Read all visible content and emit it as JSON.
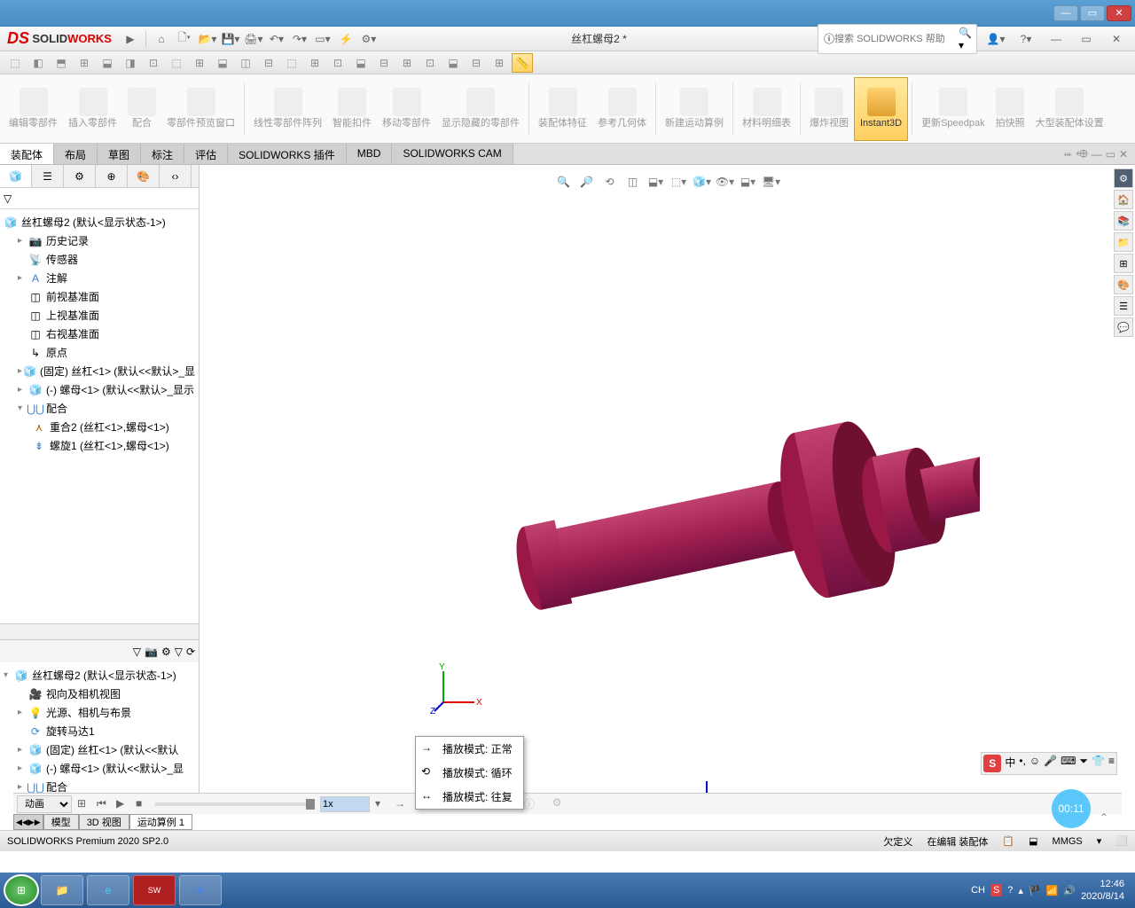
{
  "logo": {
    "solid": "SOLID",
    "works": "WORKS"
  },
  "doc_title": "丝杠螺母2 *",
  "search_placeholder": "搜索 SOLIDWORKS 帮助",
  "ribbon": {
    "items": [
      {
        "label": "编辑零部件"
      },
      {
        "label": "插入零部件"
      },
      {
        "label": "配合"
      },
      {
        "label": "零部件预览窗口"
      },
      {
        "label": "线性零部件阵列"
      },
      {
        "label": "智能扣件"
      },
      {
        "label": "移动零部件"
      },
      {
        "label": "显示隐藏的零部件"
      },
      {
        "label": "装配体特征"
      },
      {
        "label": "参考几何体"
      },
      {
        "label": "新建运动算例"
      },
      {
        "label": "材料明细表"
      },
      {
        "label": "爆炸视图"
      },
      {
        "label": "Instant3D",
        "active": true
      },
      {
        "label": "更新Speedpak"
      },
      {
        "label": "拍快照"
      },
      {
        "label": "大型装配体设置"
      }
    ]
  },
  "tabs": [
    "装配体",
    "布局",
    "草图",
    "标注",
    "评估",
    "SOLIDWORKS 插件",
    "MBD",
    "SOLIDWORKS CAM"
  ],
  "tree": {
    "root": "丝杠螺母2  (默认<显示状态-1>)",
    "items": [
      "历史记录",
      "传感器",
      "注解",
      "前视基准面",
      "上视基准面",
      "右视基准面",
      "原点",
      "(固定) 丝杠<1> (默认<<默认>_显",
      "(-) 螺母<1> (默认<<默认>_显示",
      "配合"
    ],
    "mates": [
      "重合2 (丝杠<1>,螺母<1>)",
      "螺旋1 (丝杠<1>,螺母<1>)"
    ]
  },
  "tree2": {
    "root": "丝杠螺母2  (默认<显示状态-1>)",
    "items": [
      "视向及相机视图",
      "光源、相机与布景",
      "旋转马达1",
      "(固定) 丝杠<1> (默认<<默认",
      "(-) 螺母<1> (默认<<默认>_显",
      "配合"
    ]
  },
  "context_menu": {
    "items": [
      {
        "icon": "→",
        "label": "播放模式: 正常"
      },
      {
        "icon": "⟲",
        "label": "播放模式: 循环"
      },
      {
        "icon": "↔",
        "label": "播放模式: 往复"
      }
    ]
  },
  "playback": {
    "mode_label": "动画",
    "speed": "1x"
  },
  "bottom_tabs": [
    "模型",
    "3D 视图",
    "运动算例 1"
  ],
  "status": {
    "product": "SOLIDWORKS Premium 2020 SP2.0",
    "def": "欠定义",
    "edit": "在编辑 装配体",
    "units": "MMGS"
  },
  "rec_time": "00:11",
  "ime_chars": [
    "中",
    "•,",
    "☺",
    "🎤",
    "⌨",
    "⏷",
    "👕",
    "≡"
  ],
  "tray": {
    "ch": "CH",
    "time": "12:46",
    "date": "2020/8/14"
  }
}
